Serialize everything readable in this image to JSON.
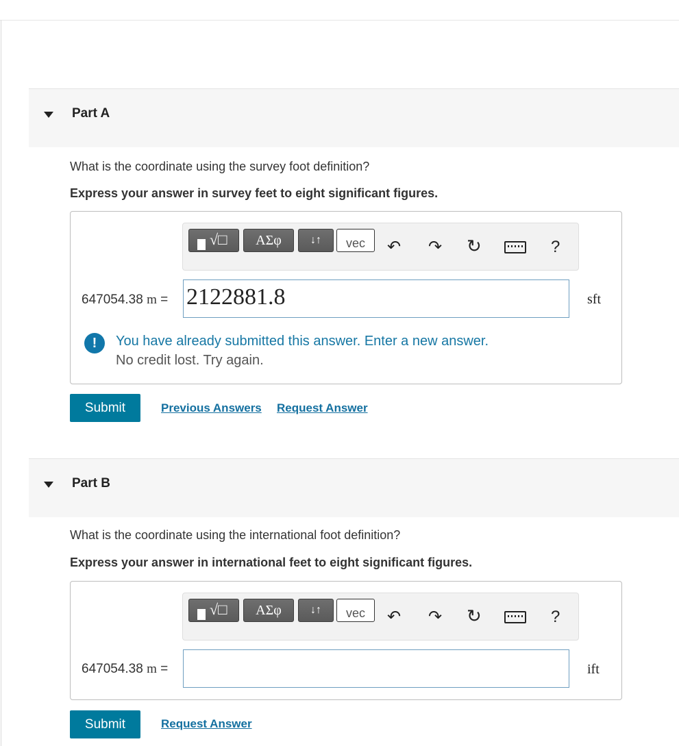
{
  "toolbar": {
    "greek_label": "ΑΣφ",
    "arrows_label": "↓↑",
    "vec_label": "vec",
    "help_label": "?"
  },
  "icons": [
    "template-icon",
    "undo-icon",
    "redo-icon",
    "reset-icon",
    "keyboard-icon",
    "help-icon"
  ],
  "colors": {
    "accent": "#007a9d",
    "link": "#1470a0",
    "feedback": "#1677a4"
  },
  "partA": {
    "title": "Part A",
    "question": "What is the coordinate using the survey foot definition?",
    "instruction": "Express your answer in survey feet to eight significant figures.",
    "label_value": "647054.38",
    "label_unit": "m",
    "label_eq": " =",
    "answer_value": "2122881.8",
    "unit": "sft",
    "feedback_main": "You have already submitted this answer. Enter a new answer.",
    "feedback_sub": "No credit lost. Try again.",
    "submit_label": "Submit",
    "previous_answers_label": "Previous Answers",
    "request_answer_label": "Request Answer"
  },
  "partB": {
    "title": "Part B",
    "question": "What is the coordinate using the international foot definition?",
    "instruction": "Express your answer in international feet to eight significant figures.",
    "label_value": "647054.38",
    "label_unit": "m",
    "label_eq": " =",
    "answer_value": "",
    "unit": "ift",
    "submit_label": "Submit",
    "request_answer_label": "Request Answer"
  }
}
